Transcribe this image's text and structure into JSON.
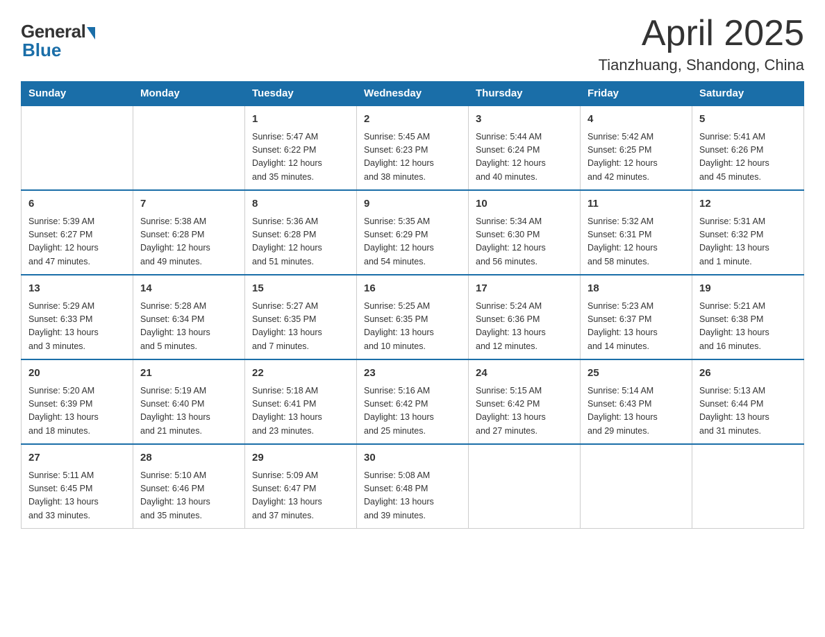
{
  "header": {
    "logo_general": "General",
    "logo_blue": "Blue",
    "month_title": "April 2025",
    "location": "Tianzhuang, Shandong, China"
  },
  "weekdays": [
    "Sunday",
    "Monday",
    "Tuesday",
    "Wednesday",
    "Thursday",
    "Friday",
    "Saturday"
  ],
  "weeks": [
    [
      {
        "day": "",
        "info": ""
      },
      {
        "day": "",
        "info": ""
      },
      {
        "day": "1",
        "info": "Sunrise: 5:47 AM\nSunset: 6:22 PM\nDaylight: 12 hours\nand 35 minutes."
      },
      {
        "day": "2",
        "info": "Sunrise: 5:45 AM\nSunset: 6:23 PM\nDaylight: 12 hours\nand 38 minutes."
      },
      {
        "day": "3",
        "info": "Sunrise: 5:44 AM\nSunset: 6:24 PM\nDaylight: 12 hours\nand 40 minutes."
      },
      {
        "day": "4",
        "info": "Sunrise: 5:42 AM\nSunset: 6:25 PM\nDaylight: 12 hours\nand 42 minutes."
      },
      {
        "day": "5",
        "info": "Sunrise: 5:41 AM\nSunset: 6:26 PM\nDaylight: 12 hours\nand 45 minutes."
      }
    ],
    [
      {
        "day": "6",
        "info": "Sunrise: 5:39 AM\nSunset: 6:27 PM\nDaylight: 12 hours\nand 47 minutes."
      },
      {
        "day": "7",
        "info": "Sunrise: 5:38 AM\nSunset: 6:28 PM\nDaylight: 12 hours\nand 49 minutes."
      },
      {
        "day": "8",
        "info": "Sunrise: 5:36 AM\nSunset: 6:28 PM\nDaylight: 12 hours\nand 51 minutes."
      },
      {
        "day": "9",
        "info": "Sunrise: 5:35 AM\nSunset: 6:29 PM\nDaylight: 12 hours\nand 54 minutes."
      },
      {
        "day": "10",
        "info": "Sunrise: 5:34 AM\nSunset: 6:30 PM\nDaylight: 12 hours\nand 56 minutes."
      },
      {
        "day": "11",
        "info": "Sunrise: 5:32 AM\nSunset: 6:31 PM\nDaylight: 12 hours\nand 58 minutes."
      },
      {
        "day": "12",
        "info": "Sunrise: 5:31 AM\nSunset: 6:32 PM\nDaylight: 13 hours\nand 1 minute."
      }
    ],
    [
      {
        "day": "13",
        "info": "Sunrise: 5:29 AM\nSunset: 6:33 PM\nDaylight: 13 hours\nand 3 minutes."
      },
      {
        "day": "14",
        "info": "Sunrise: 5:28 AM\nSunset: 6:34 PM\nDaylight: 13 hours\nand 5 minutes."
      },
      {
        "day": "15",
        "info": "Sunrise: 5:27 AM\nSunset: 6:35 PM\nDaylight: 13 hours\nand 7 minutes."
      },
      {
        "day": "16",
        "info": "Sunrise: 5:25 AM\nSunset: 6:35 PM\nDaylight: 13 hours\nand 10 minutes."
      },
      {
        "day": "17",
        "info": "Sunrise: 5:24 AM\nSunset: 6:36 PM\nDaylight: 13 hours\nand 12 minutes."
      },
      {
        "day": "18",
        "info": "Sunrise: 5:23 AM\nSunset: 6:37 PM\nDaylight: 13 hours\nand 14 minutes."
      },
      {
        "day": "19",
        "info": "Sunrise: 5:21 AM\nSunset: 6:38 PM\nDaylight: 13 hours\nand 16 minutes."
      }
    ],
    [
      {
        "day": "20",
        "info": "Sunrise: 5:20 AM\nSunset: 6:39 PM\nDaylight: 13 hours\nand 18 minutes."
      },
      {
        "day": "21",
        "info": "Sunrise: 5:19 AM\nSunset: 6:40 PM\nDaylight: 13 hours\nand 21 minutes."
      },
      {
        "day": "22",
        "info": "Sunrise: 5:18 AM\nSunset: 6:41 PM\nDaylight: 13 hours\nand 23 minutes."
      },
      {
        "day": "23",
        "info": "Sunrise: 5:16 AM\nSunset: 6:42 PM\nDaylight: 13 hours\nand 25 minutes."
      },
      {
        "day": "24",
        "info": "Sunrise: 5:15 AM\nSunset: 6:42 PM\nDaylight: 13 hours\nand 27 minutes."
      },
      {
        "day": "25",
        "info": "Sunrise: 5:14 AM\nSunset: 6:43 PM\nDaylight: 13 hours\nand 29 minutes."
      },
      {
        "day": "26",
        "info": "Sunrise: 5:13 AM\nSunset: 6:44 PM\nDaylight: 13 hours\nand 31 minutes."
      }
    ],
    [
      {
        "day": "27",
        "info": "Sunrise: 5:11 AM\nSunset: 6:45 PM\nDaylight: 13 hours\nand 33 minutes."
      },
      {
        "day": "28",
        "info": "Sunrise: 5:10 AM\nSunset: 6:46 PM\nDaylight: 13 hours\nand 35 minutes."
      },
      {
        "day": "29",
        "info": "Sunrise: 5:09 AM\nSunset: 6:47 PM\nDaylight: 13 hours\nand 37 minutes."
      },
      {
        "day": "30",
        "info": "Sunrise: 5:08 AM\nSunset: 6:48 PM\nDaylight: 13 hours\nand 39 minutes."
      },
      {
        "day": "",
        "info": ""
      },
      {
        "day": "",
        "info": ""
      },
      {
        "day": "",
        "info": ""
      }
    ]
  ]
}
